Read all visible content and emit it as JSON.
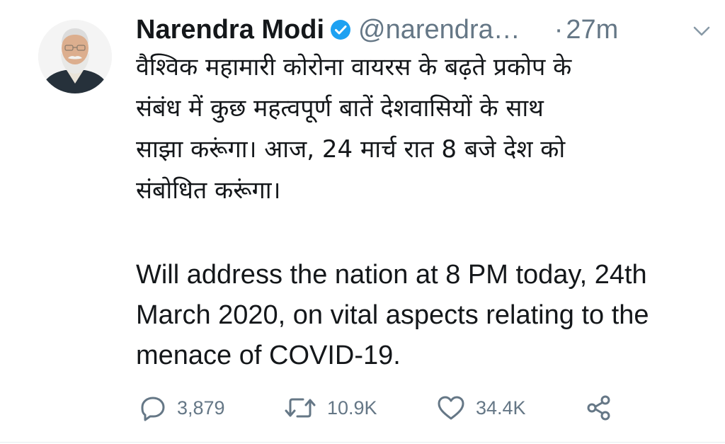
{
  "tweet": {
    "author_name": "Narendra Modi",
    "handle": "@narendra…",
    "separator": "·",
    "timestamp": "27m",
    "verified": true,
    "text_hindi": "वैश्विक महामारी कोरोना वायरस के बढ़ते प्रकोप के\nसंबंध में कुछ महत्वपूर्ण बातें देशवासियों के साथ\nसाझा करूंगा। आज, 24 मार्च रात 8 बजे देश को\nसंबोधित करूंगा।",
    "text_english": "Will address the nation at 8 PM today, 24th March 2020, on vital aspects relating to the menace of COVID-19.",
    "counts": {
      "replies": "3,879",
      "retweets": "10.9K",
      "likes": "34.4K"
    }
  },
  "colors": {
    "text": "#14171a",
    "secondary": "#657786",
    "verified_blue": "#1da1f2",
    "background": "#ffffff"
  },
  "icons": {
    "reply": "reply-icon",
    "retweet": "retweet-icon",
    "like": "heart-icon",
    "share": "share-icon",
    "verified": "verified-badge-icon",
    "menu": "chevron-down-icon"
  }
}
